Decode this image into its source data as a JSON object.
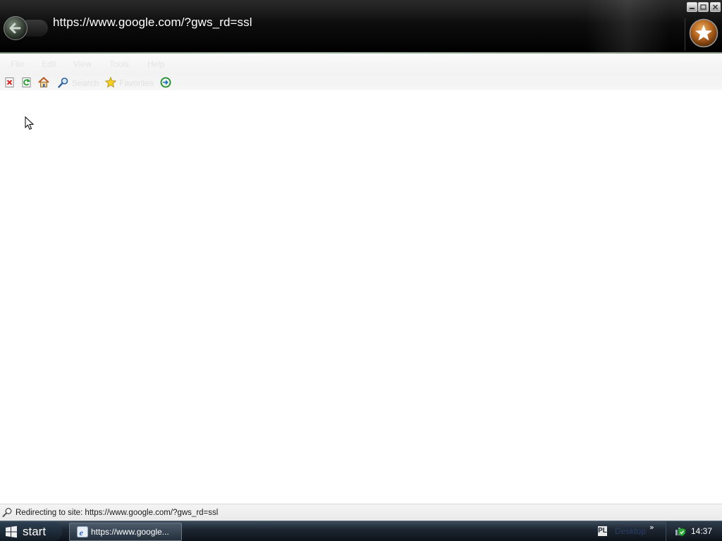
{
  "browser": {
    "address": "https://www.google.com/?gws_rd=ssl"
  },
  "menu": [
    {
      "label": "File"
    },
    {
      "label": "Edit"
    },
    {
      "label": "View"
    },
    {
      "label": "Tools"
    },
    {
      "label": "Help"
    }
  ],
  "toolbar": {
    "search_label": "Search",
    "favorites_label": "Favorites"
  },
  "status": {
    "text": "Redirecting to site: https://www.google.com/?gws_rd=ssl"
  },
  "taskbar": {
    "start_label": "start",
    "active_task_label": "https://www.google...",
    "quicklaunch_pl": "PL",
    "desktop_label": "Desktop",
    "chevron": "»",
    "clock": "14:37"
  },
  "colors": {
    "titlebar_bg": "#000000",
    "address_text": "#ffffff",
    "menu_text_faded": "#e4e4e4",
    "taskbar_bg": "#1d2733"
  },
  "icons": {
    "back": "back-arrow-icon",
    "stop": "stop-icon",
    "refresh": "refresh-icon",
    "home": "home-icon",
    "search": "search-icon",
    "favorites": "star-icon",
    "media": "ie-media-icon",
    "favorites_center": "favorites-star-orb-icon",
    "status": "magnifier-icon",
    "start": "windows-logo-icon",
    "network": "network-shield-icon"
  }
}
